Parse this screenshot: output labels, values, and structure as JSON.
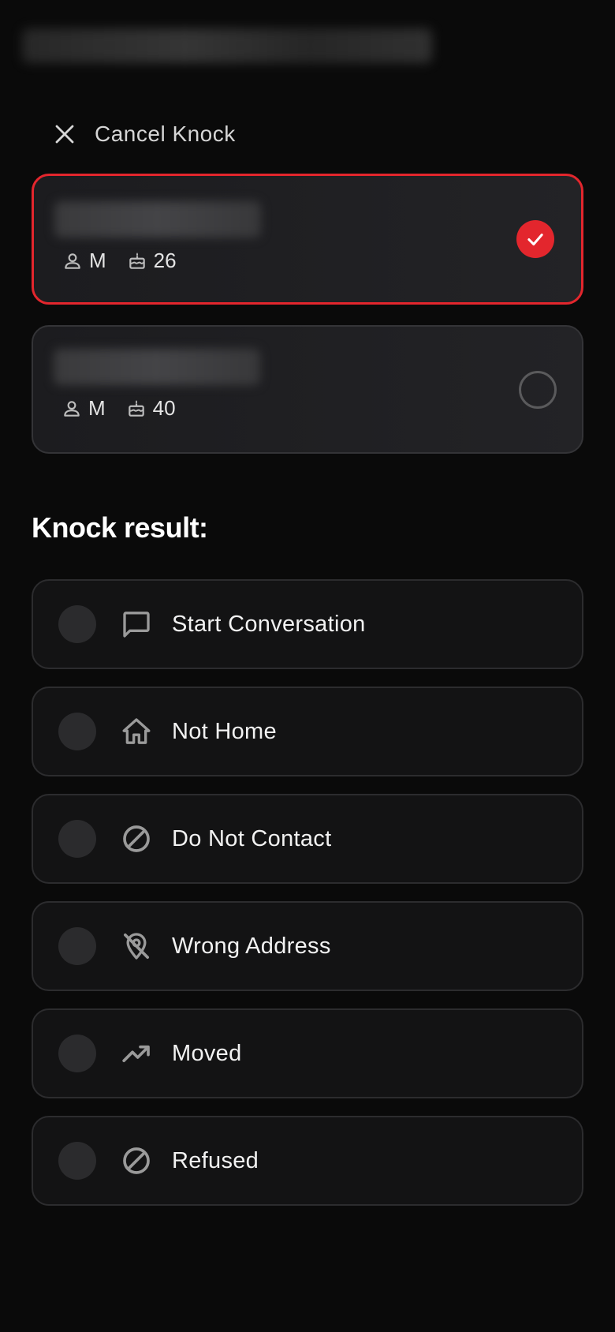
{
  "cancel": {
    "label": "Cancel Knock",
    "icon": "close-icon"
  },
  "people": [
    {
      "gender": "M",
      "age": "26",
      "selected": true
    },
    {
      "gender": "M",
      "age": "40",
      "selected": false
    }
  ],
  "knock_result": {
    "title": "Knock result:",
    "options": [
      {
        "label": "Start Conversation",
        "icon": "chat-bubble-icon"
      },
      {
        "label": "Not Home",
        "icon": "home-icon"
      },
      {
        "label": "Do Not Contact",
        "icon": "block-icon"
      },
      {
        "label": "Wrong Address",
        "icon": "location-off-icon"
      },
      {
        "label": "Moved",
        "icon": "trending-up-icon"
      },
      {
        "label": "Refused",
        "icon": "block-icon"
      }
    ]
  },
  "colors": {
    "background": "#0a0a0a",
    "accent": "#e3262d",
    "card": "#1f1f22",
    "option_card": "#131314",
    "icon_gray": "#9a9a9a"
  }
}
